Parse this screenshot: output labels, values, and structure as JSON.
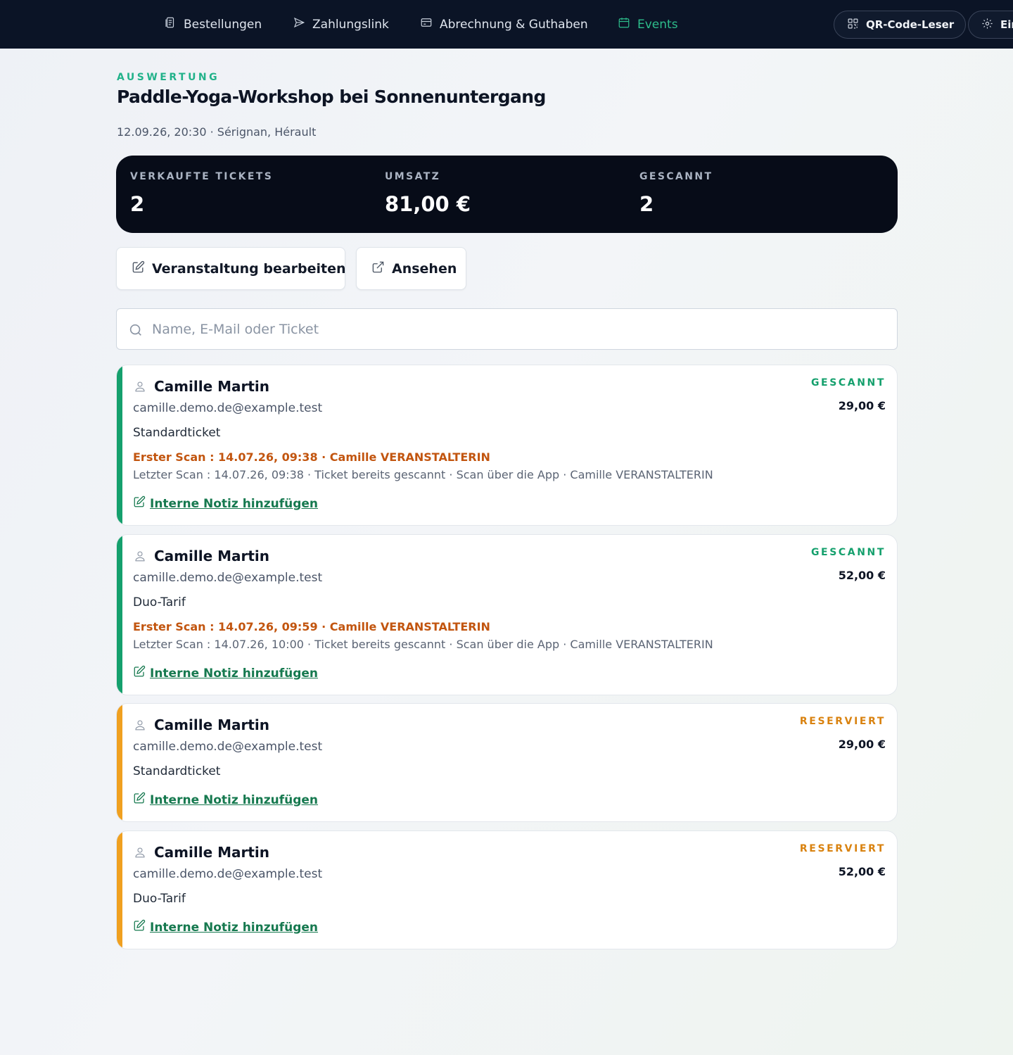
{
  "nav": {
    "items": [
      {
        "label": "Bestellungen",
        "icon": "receipt-icon"
      },
      {
        "label": "Zahlungslink",
        "icon": "send-icon"
      },
      {
        "label": "Abrechnung & Guthaben",
        "icon": "credit-card-icon"
      },
      {
        "label": "Events",
        "icon": "calendar-icon",
        "active": true
      }
    ],
    "qr_label": "QR-Code-Leser",
    "settings_label": "Ein"
  },
  "header": {
    "eyebrow": "AUSWERTUNG",
    "title": "Paddle-Yoga-Workshop bei Sonnenuntergang",
    "meta": "12.09.26, 20:30 · Sérignan, Hérault"
  },
  "stats": [
    {
      "label": "VERKAUFTE TICKETS",
      "value": "2"
    },
    {
      "label": "UMSATZ",
      "value": "81,00 €"
    },
    {
      "label": "GESCANNT",
      "value": "2"
    }
  ],
  "actions": {
    "edit_label": "Veranstaltung bearbeiten",
    "view_label": "Ansehen"
  },
  "search": {
    "placeholder": "Name, E-Mail oder Ticket"
  },
  "colors": {
    "accent": "#22b28a",
    "scanned": "#15a06d",
    "reserved": "#f0a020"
  },
  "tickets": [
    {
      "name": "Camille Martin",
      "email": "camille.demo.de@example.test",
      "type": "Standardticket",
      "first_scan": "Erster Scan : 14.07.26, 09:38 · Camille VERANSTALTERIN",
      "last_scan": "Letzter Scan : 14.07.26, 09:38 · Ticket bereits gescannt · Scan über die App · Camille VERANSTALTERIN",
      "note_label": "Interne Notiz hinzufügen",
      "status": "GESCANNT",
      "price": "29,00 €"
    },
    {
      "name": "Camille Martin",
      "email": "camille.demo.de@example.test",
      "type": "Duo-Tarif",
      "first_scan": "Erster Scan : 14.07.26, 09:59 · Camille VERANSTALTERIN",
      "last_scan": "Letzter Scan : 14.07.26, 10:00 · Ticket bereits gescannt · Scan über die App · Camille VERANSTALTERIN",
      "note_label": "Interne Notiz hinzufügen",
      "status": "GESCANNT",
      "price": "52,00 €"
    },
    {
      "name": "Camille Martin",
      "email": "camille.demo.de@example.test",
      "type": "Standardticket",
      "note_label": "Interne Notiz hinzufügen",
      "status": "RESERVIERT",
      "price": "29,00 €"
    },
    {
      "name": "Camille Martin",
      "email": "camille.demo.de@example.test",
      "type": "Duo-Tarif",
      "note_label": "Interne Notiz hinzufügen",
      "status": "RESERVIERT",
      "price": "52,00 €"
    }
  ]
}
